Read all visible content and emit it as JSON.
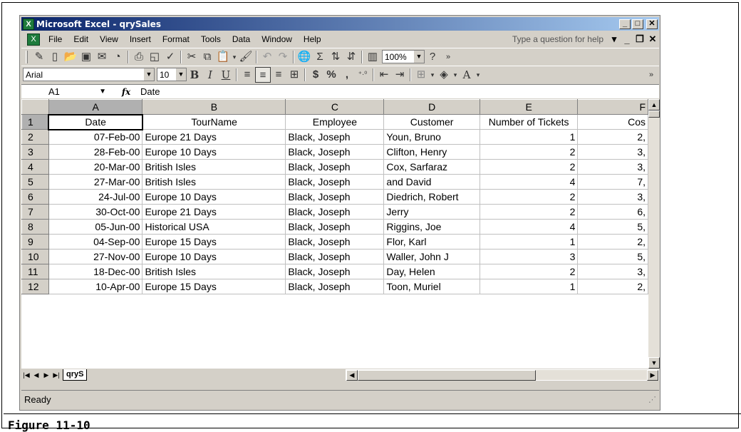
{
  "window": {
    "title": "Microsoft Excel - qrySales"
  },
  "menubar": {
    "items": [
      "File",
      "Edit",
      "View",
      "Insert",
      "Format",
      "Tools",
      "Data",
      "Window",
      "Help"
    ],
    "help_placeholder": "Type a question for help"
  },
  "toolbar_standard": {
    "zoom": "100%"
  },
  "toolbar_formatting": {
    "font": "Arial",
    "size": "10",
    "bold": "B",
    "italic": "I",
    "underline": "U",
    "currency": "$",
    "percent": "%",
    "comma": ","
  },
  "formula_bar": {
    "name_box": "A1",
    "fx": "fx",
    "content": "Date"
  },
  "grid": {
    "columns": [
      "A",
      "B",
      "C",
      "D",
      "E",
      "F"
    ],
    "header_row": {
      "num": "1",
      "cells": [
        "Date",
        "TourName",
        "Employee",
        "Customer",
        "Number of Tickets",
        "Cos"
      ]
    },
    "rows": [
      {
        "num": "2",
        "cells": [
          "07-Feb-00",
          "Europe 21 Days",
          "Black, Joseph",
          "Youn, Bruno",
          "1",
          "2,"
        ]
      },
      {
        "num": "3",
        "cells": [
          "28-Feb-00",
          "Europe 10 Days",
          "Black, Joseph",
          "Clifton, Henry",
          "2",
          "3,"
        ]
      },
      {
        "num": "4",
        "cells": [
          "20-Mar-00",
          "British Isles",
          "Black, Joseph",
          "Cox, Sarfaraz",
          "2",
          "3,"
        ]
      },
      {
        "num": "5",
        "cells": [
          "27-Mar-00",
          "British Isles",
          "Black, Joseph",
          "and David",
          "4",
          "7,"
        ]
      },
      {
        "num": "6",
        "cells": [
          "24-Jul-00",
          "Europe 10 Days",
          "Black, Joseph",
          "Diedrich, Robert",
          "2",
          "3,"
        ]
      },
      {
        "num": "7",
        "cells": [
          "30-Oct-00",
          "Europe 21 Days",
          "Black, Joseph",
          "Jerry",
          "2",
          "6,"
        ]
      },
      {
        "num": "8",
        "cells": [
          "05-Jun-00",
          "Historical USA",
          "Black, Joseph",
          "Riggins, Joe",
          "4",
          "5,"
        ]
      },
      {
        "num": "9",
        "cells": [
          "04-Sep-00",
          "Europe 15 Days",
          "Black, Joseph",
          "Flor, Karl",
          "1",
          "2,"
        ]
      },
      {
        "num": "10",
        "cells": [
          "27-Nov-00",
          "Europe 10 Days",
          "Black, Joseph",
          "Waller, John J",
          "3",
          "5,"
        ]
      },
      {
        "num": "11",
        "cells": [
          "18-Dec-00",
          "British Isles",
          "Black, Joseph",
          "Day, Helen",
          "2",
          "3,"
        ]
      },
      {
        "num": "12",
        "cells": [
          "10-Apr-00",
          "Europe 15 Days",
          "Black, Joseph",
          "Toon, Muriel",
          "1",
          "2,"
        ]
      }
    ]
  },
  "sheet_tab": {
    "label": "qryS"
  },
  "status": {
    "text": "Ready"
  },
  "caption": {
    "text": "Figure 11-10"
  },
  "colors": {
    "title_start": "#0a246a",
    "title_end": "#a6caf0",
    "chrome": "#d4d0c8",
    "excel_green": "#1e7b3c"
  }
}
